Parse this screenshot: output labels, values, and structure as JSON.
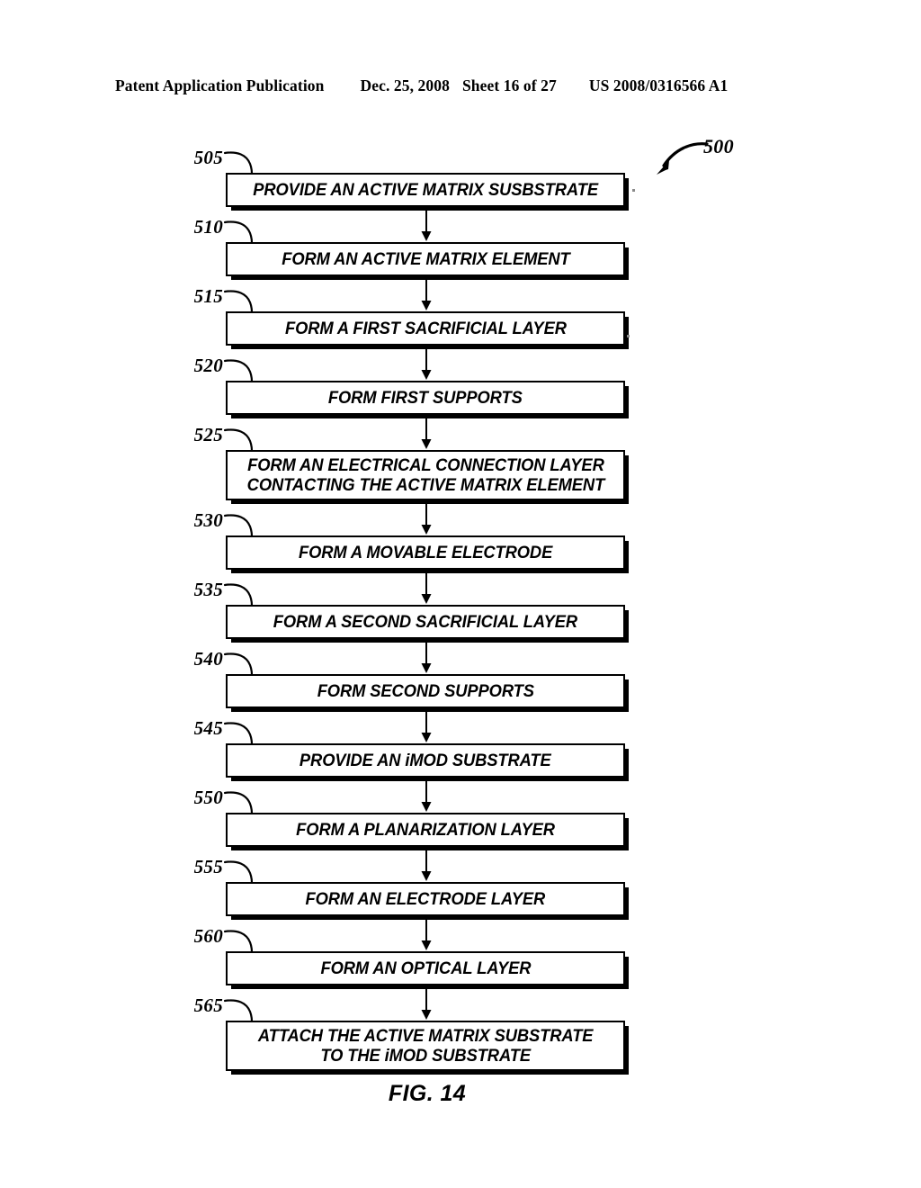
{
  "header": {
    "publication": "Patent Application Publication",
    "date": "Dec. 25, 2008",
    "sheet": "Sheet 16 of 27",
    "patent_number": "US 2008/0316566 A1"
  },
  "figure": {
    "caption": "FIG. 14",
    "callout_reference": "500"
  },
  "flowchart": {
    "steps": [
      {
        "ref": "505",
        "label": "PROVIDE AN ACTIVE MATRIX SUSBSTRATE",
        "lines": 1
      },
      {
        "ref": "510",
        "label": "FORM AN ACTIVE MATRIX ELEMENT",
        "lines": 1
      },
      {
        "ref": "515",
        "label": "FORM A FIRST SACRIFICIAL LAYER",
        "lines": 1
      },
      {
        "ref": "520",
        "label": "FORM FIRST SUPPORTS",
        "lines": 1
      },
      {
        "ref": "525",
        "label": "FORM AN ELECTRICAL CONNECTION LAYER\nCONTACTING THE ACTIVE MATRIX ELEMENT",
        "lines": 2
      },
      {
        "ref": "530",
        "label": "FORM A MOVABLE ELECTRODE",
        "lines": 1
      },
      {
        "ref": "535",
        "label": "FORM A SECOND SACRIFICIAL LAYER",
        "lines": 1
      },
      {
        "ref": "540",
        "label": "FORM SECOND SUPPORTS",
        "lines": 1
      },
      {
        "ref": "545",
        "label": "PROVIDE AN iMOD SUBSTRATE",
        "lines": 1
      },
      {
        "ref": "550",
        "label": "FORM A PLANARIZATION LAYER",
        "lines": 1
      },
      {
        "ref": "555",
        "label": "FORM AN ELECTRODE LAYER",
        "lines": 1
      },
      {
        "ref": "560",
        "label": "FORM AN OPTICAL LAYER",
        "lines": 1
      },
      {
        "ref": "565",
        "label": "ATTACH THE ACTIVE MATRIX SUBSTRATE\nTO THE iMOD SUBSTRATE",
        "lines": 2
      }
    ]
  },
  "colors": {
    "ink": "#000000",
    "page": "#ffffff"
  }
}
